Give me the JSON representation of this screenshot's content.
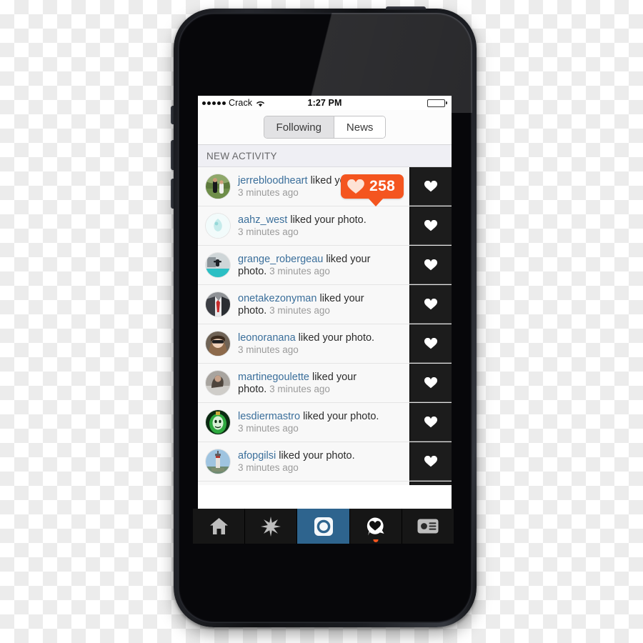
{
  "device": {
    "name": "iphone-5-black",
    "home_button": "home-button",
    "camera": "front-camera",
    "earpiece": "earpiece-speaker"
  },
  "status_bar": {
    "signal_dots": 5,
    "carrier": "Crack",
    "wifi": "wifi-icon",
    "time": "1:27 PM",
    "battery": "battery-icon"
  },
  "segmented_control": {
    "name": "following-news-segment",
    "selected": "Following",
    "options": [
      {
        "label": "Following",
        "selected": true
      },
      {
        "label": "News",
        "selected": false
      }
    ]
  },
  "section": {
    "header": "NEW ACTIVITY"
  },
  "activity": {
    "action_text": "liked your photo.",
    "items": [
      {
        "username": "jerrebloodheart",
        "action": "liked your photo.",
        "time": "3 minutes ago",
        "wrap": false,
        "avatar": "couple-on-grass"
      },
      {
        "username": "aahz_west",
        "action": "liked your photo.",
        "time": "3 minutes ago",
        "wrap": false,
        "avatar": "pale-blue-figure"
      },
      {
        "username": "grange_robergeau",
        "action": "liked your",
        "action2": "photo.",
        "time": "3 minutes ago",
        "wrap": true,
        "avatar": "person-on-teal-board"
      },
      {
        "username": "onetakezonyman",
        "action": "liked your",
        "action2": "photo.",
        "time": "3 minutes ago",
        "wrap": true,
        "avatar": "suit-and-red-tie"
      },
      {
        "username": "leonoranana",
        "action": "liked your photo.",
        "time": "3 minutes ago",
        "wrap": false,
        "avatar": "woman-sunglasses"
      },
      {
        "username": "martinegoulette",
        "action": "liked your",
        "action2": "photo.",
        "time": "3 minutes ago",
        "wrap": true,
        "avatar": "person-grey-photo"
      },
      {
        "username": "lesdiermastro",
        "action": "liked your photo.",
        "time": "3 minutes ago",
        "wrap": false,
        "avatar": "green-mask"
      },
      {
        "username": "afopgilsi",
        "action": "liked your photo.",
        "time": "3 minutes ago",
        "wrap": false,
        "avatar": "lighthouse"
      }
    ],
    "heart_button": "like-heart-button"
  },
  "like_badge": {
    "icon": "heart-icon",
    "count": "258"
  },
  "tab_bar": {
    "tabs": [
      {
        "name": "home",
        "icon": "home-icon",
        "active": false,
        "dot": false
      },
      {
        "name": "explore",
        "icon": "compass-star-icon",
        "active": false,
        "dot": false
      },
      {
        "name": "camera",
        "icon": "camera-icon",
        "active": true,
        "dot": false
      },
      {
        "name": "activity",
        "icon": "heart-speech-bubble-icon",
        "active": false,
        "dot": true
      },
      {
        "name": "profile",
        "icon": "profile-card-icon",
        "active": false,
        "dot": false
      }
    ]
  },
  "colors": {
    "link_blue": "#3b6f9b",
    "accent_orange": "#f4551f",
    "tab_active_blue": "#2e648e",
    "section_bg": "#efeff4",
    "heart_cell_bg": "#1c1c1c"
  }
}
